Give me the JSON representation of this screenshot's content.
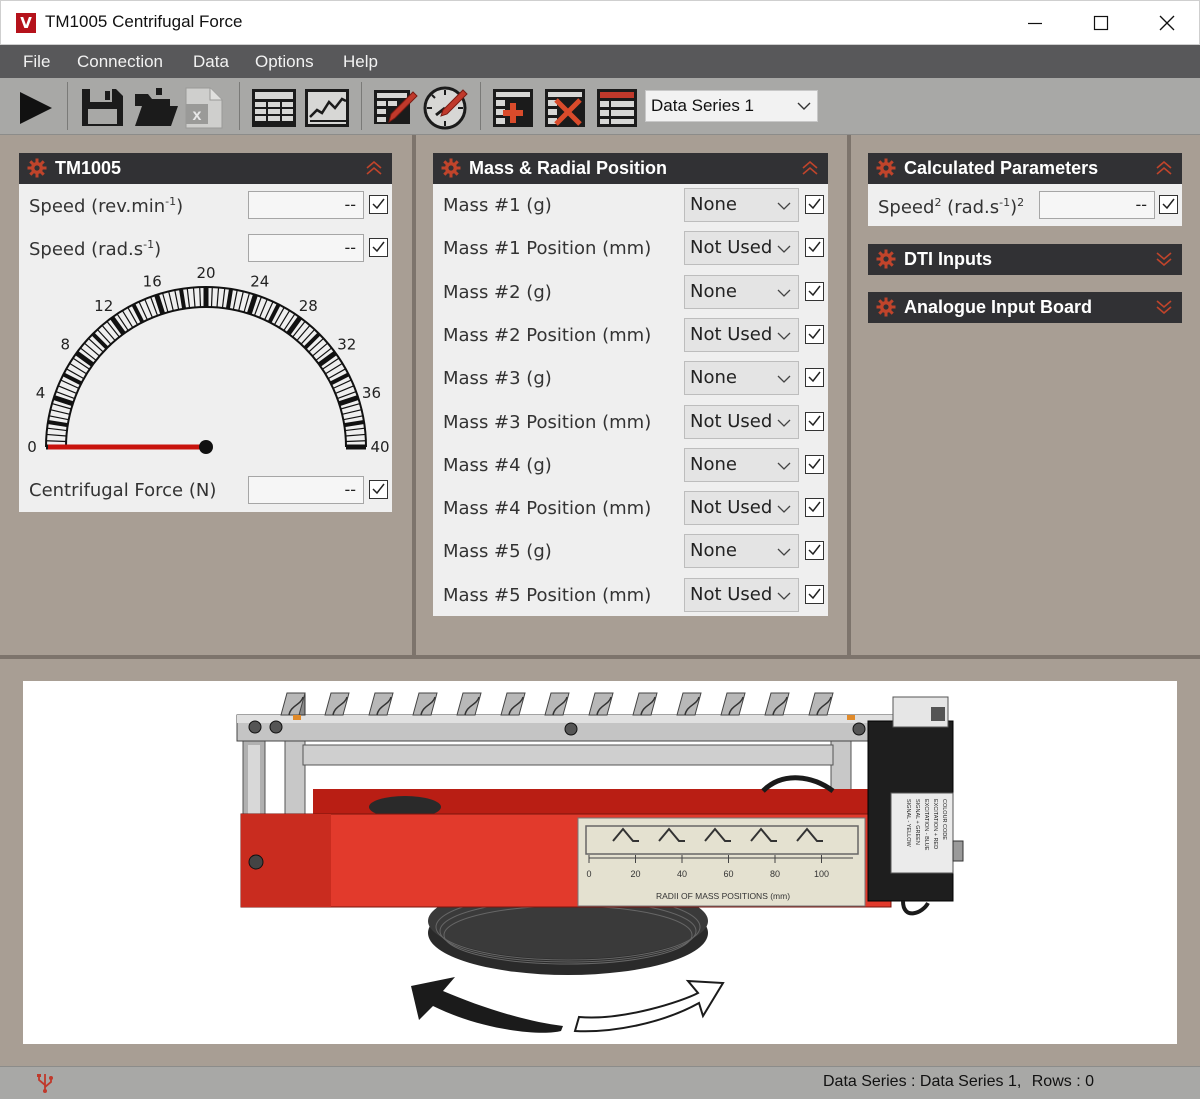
{
  "window": {
    "title": "TM1005 Centrifugal Force",
    "logo_letter": "V"
  },
  "menu": [
    "File",
    "Connection",
    "Data",
    "Options",
    "Help"
  ],
  "toolbar": {
    "series_select": "Data Series 1",
    "icons": [
      "play-icon",
      "save-icon",
      "open-folder-icon",
      "export-excel-icon",
      "table-view-icon",
      "graph-view-icon",
      "edit-table-icon",
      "edit-gauge-icon",
      "add-series-icon",
      "delete-series-icon",
      "series-table-icon"
    ]
  },
  "tm1005": {
    "title": "TM1005",
    "speed_rev_label": "Speed (rev.min",
    "speed_rev_sup": "-1",
    "speed_rev_close": ")",
    "speed_rev_value": "--",
    "speed_rad_label": "Speed (rad.s",
    "speed_rad_sup": "-1",
    "speed_rad_close": ")",
    "speed_rad_value": "--",
    "gauge_ticks": [
      "0",
      "4",
      "8",
      "12",
      "16",
      "20",
      "24",
      "28",
      "32",
      "36",
      "40"
    ],
    "gauge_value": 0,
    "force_label": "Centrifugal Force (N)",
    "force_value": "--"
  },
  "mass_panel": {
    "title": "Mass & Radial Position",
    "rows": [
      {
        "label": "Mass #1 (g)",
        "value": "None"
      },
      {
        "label": "Mass #1 Position (mm)",
        "value": "Not Used"
      },
      {
        "label": "Mass #2 (g)",
        "value": "None"
      },
      {
        "label": "Mass #2 Position (mm)",
        "value": "Not Used"
      },
      {
        "label": "Mass #3 (g)",
        "value": "None"
      },
      {
        "label": "Mass #3 Position (mm)",
        "value": "Not Used"
      },
      {
        "label": "Mass #4 (g)",
        "value": "None"
      },
      {
        "label": "Mass #4 Position (mm)",
        "value": "Not Used"
      },
      {
        "label": "Mass #5 (g)",
        "value": "None"
      },
      {
        "label": "Mass #5 Position (mm)",
        "value": "Not Used"
      }
    ]
  },
  "calc_panel": {
    "title": "Calculated Parameters",
    "speed_sq_label": "Speed",
    "speed_sq_sup": "2",
    "speed_sq_unit": "(rad.s",
    "speed_sq_unit_sup": "-1",
    "speed_sq_unit_close": ")",
    "speed_sq_unit_sup2": "2",
    "speed_sq_value": "--"
  },
  "dti_panel": {
    "title": "DTI Inputs"
  },
  "analogue_panel": {
    "title": "Analogue Input Board"
  },
  "apparatus": {
    "scale_ticks": [
      "0",
      "20",
      "40",
      "60",
      "80",
      "100"
    ],
    "scale_caption": "RADII OF MASS POSITIONS (mm)",
    "colour_code_lines": [
      "COLOUR CODE",
      "EXCITATION + RED",
      "EXCITATION - BLUE",
      "SIGNAL + GREEN",
      "SIGNAL - YELLOW"
    ]
  },
  "status": {
    "series_label": "Data Series : Data Series 1,",
    "rows_label": "Rows : 0"
  },
  "colors": {
    "accent_red": "#b5121b",
    "panel_header": "#313134",
    "menu_bg": "#58585a",
    "background": "#a89e94"
  }
}
